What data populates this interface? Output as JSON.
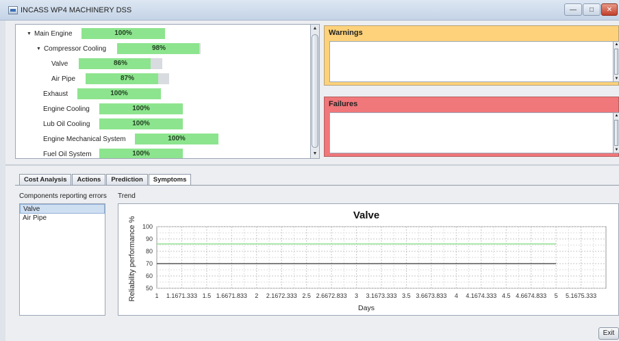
{
  "window": {
    "title": "INCASS WP4 MACHINERY DSS",
    "buttons": {
      "minimize": "—",
      "maximize": "□",
      "close": "✕"
    }
  },
  "tree": {
    "items": [
      {
        "label": "Main Engine",
        "expanded": true,
        "value": 100,
        "text": "100%"
      },
      {
        "label": "Compressor Cooling",
        "expanded": true,
        "value": 98,
        "text": "98%"
      },
      {
        "label": "Valve",
        "value": 86,
        "text": "86%"
      },
      {
        "label": "Air Pipe",
        "value": 87,
        "text": "87%"
      },
      {
        "label": "Exhaust",
        "value": 100,
        "text": "100%"
      },
      {
        "label": "Engine Cooling",
        "value": 100,
        "text": "100%"
      },
      {
        "label": "Lub Oil Cooling",
        "value": 100,
        "text": "100%"
      },
      {
        "label": "Engine Mechanical System",
        "value": 100,
        "text": "100%"
      },
      {
        "label": "Fuel Oil System",
        "value": 100,
        "text": "100%"
      }
    ]
  },
  "warnings": {
    "title": "Warnings",
    "color": "#fdd27a"
  },
  "failures": {
    "title": "Failures",
    "color": "#f0777a"
  },
  "tabs": [
    {
      "label": "Cost Analysis"
    },
    {
      "label": "Actions"
    },
    {
      "label": "Prediction"
    },
    {
      "label": "Symptoms",
      "active": true
    }
  ],
  "components": {
    "title": "Components reporting errors",
    "items": [
      {
        "label": "Valve",
        "selected": true
      },
      {
        "label": "Air Pipe"
      }
    ]
  },
  "trend": {
    "title": "Trend"
  },
  "chart_data": {
    "type": "line",
    "title": "Valve",
    "xlabel": "Days",
    "ylabel": "Reliability performance %",
    "ylim": [
      50,
      100
    ],
    "yticks": [
      50,
      60,
      70,
      80,
      90,
      100
    ],
    "xlim": [
      1,
      5.5
    ],
    "xtick_labels": [
      "1",
      "1.1671.333",
      "1.5",
      "1.6671.833",
      "2",
      "2.1672.333",
      "2.5",
      "2.6672.833",
      "3",
      "3.1673.333",
      "3.5",
      "3.6673.833",
      "4",
      "4.1674.333",
      "4.5",
      "4.6674.833",
      "5",
      "5.1675.333"
    ],
    "grid": true,
    "series": [
      {
        "x": [
          1,
          5
        ],
        "values": [
          86,
          86
        ],
        "color": "#90e090"
      },
      {
        "x": [
          1,
          5
        ],
        "values": [
          70,
          70
        ],
        "color": "#555555"
      }
    ]
  },
  "exit": {
    "label": "Exit"
  }
}
